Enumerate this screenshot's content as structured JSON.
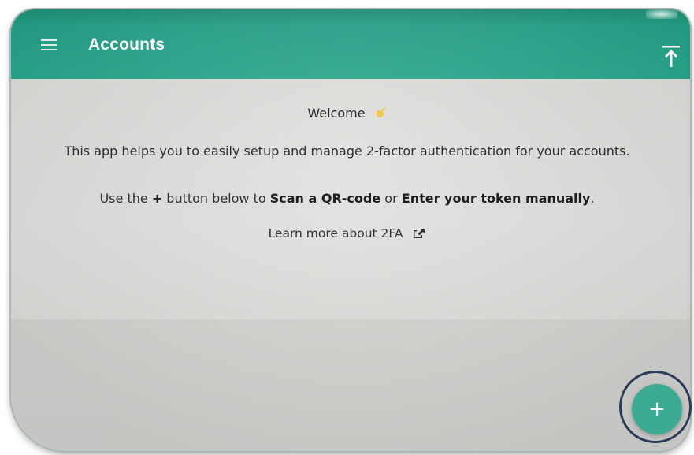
{
  "appbar": {
    "title": "Accounts",
    "menu_icon": "hamburger-menu-icon",
    "upload_icon": "upload-icon",
    "color": "#26a68b"
  },
  "main": {
    "welcome": "Welcome",
    "welcome_icon": "waving-hand-emoji",
    "description": "This app helps you to easily setup and manage 2-factor authentication for your accounts.",
    "instruction": {
      "prefix": "Use the",
      "plus": "+",
      "middle": "button below to",
      "scan": "Scan a QR-code",
      "or": "or",
      "enter": "Enter your token manually",
      "suffix": "."
    },
    "learn_more": "Learn more about 2FA",
    "learn_more_icon": "external-link-icon"
  },
  "fab": {
    "label": "+",
    "icon": "add-icon",
    "color": "#3daa94"
  }
}
